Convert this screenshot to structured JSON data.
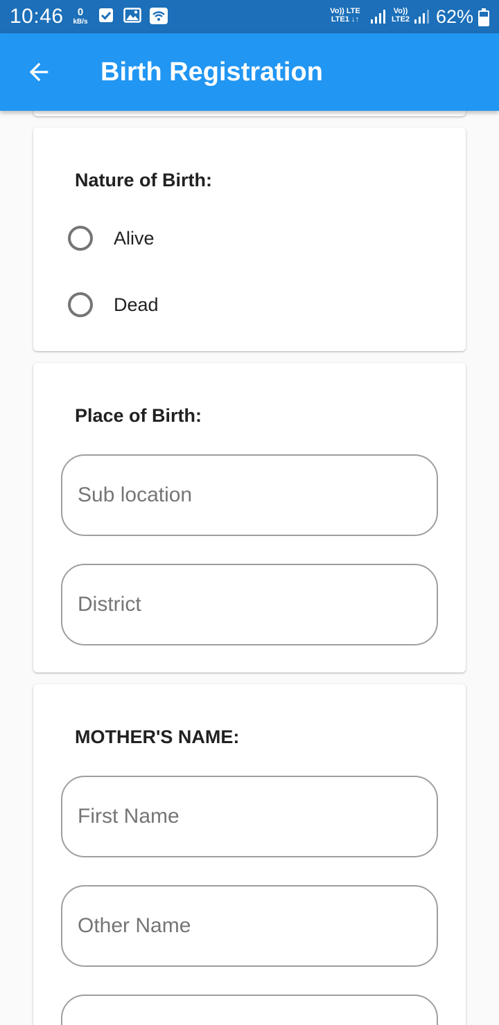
{
  "status_bar": {
    "time": "10:46",
    "speed_value": "0",
    "speed_unit": "kB/s",
    "sim1_top": "Vo)) LTE",
    "sim1_bottom": "LTE1 ↓↑",
    "sim2_top": "Vo))",
    "sim2_bottom": "LTE2",
    "battery": "62%",
    "battery_level": 0.62,
    "icons": [
      "check-icon",
      "image-icon",
      "wifi-icon",
      "signal-icon",
      "battery-icon"
    ]
  },
  "app_bar": {
    "title": "Birth Registration",
    "back_icon": "arrow-back-icon",
    "color": "#2196f3"
  },
  "nature_of_birth": {
    "label": "Nature of Birth:",
    "options": [
      {
        "label": "Alive",
        "selected": false
      },
      {
        "label": "Dead",
        "selected": false
      }
    ]
  },
  "place_of_birth": {
    "label": "Place of Birth:",
    "fields": [
      {
        "placeholder": "Sub location",
        "value": ""
      },
      {
        "placeholder": "District",
        "value": ""
      }
    ]
  },
  "mothers_name": {
    "label": "MOTHER'S NAME:",
    "fields": [
      {
        "placeholder": "First Name",
        "value": ""
      },
      {
        "placeholder": "Other Name",
        "value": ""
      },
      {
        "placeholder": "",
        "value": ""
      }
    ]
  }
}
